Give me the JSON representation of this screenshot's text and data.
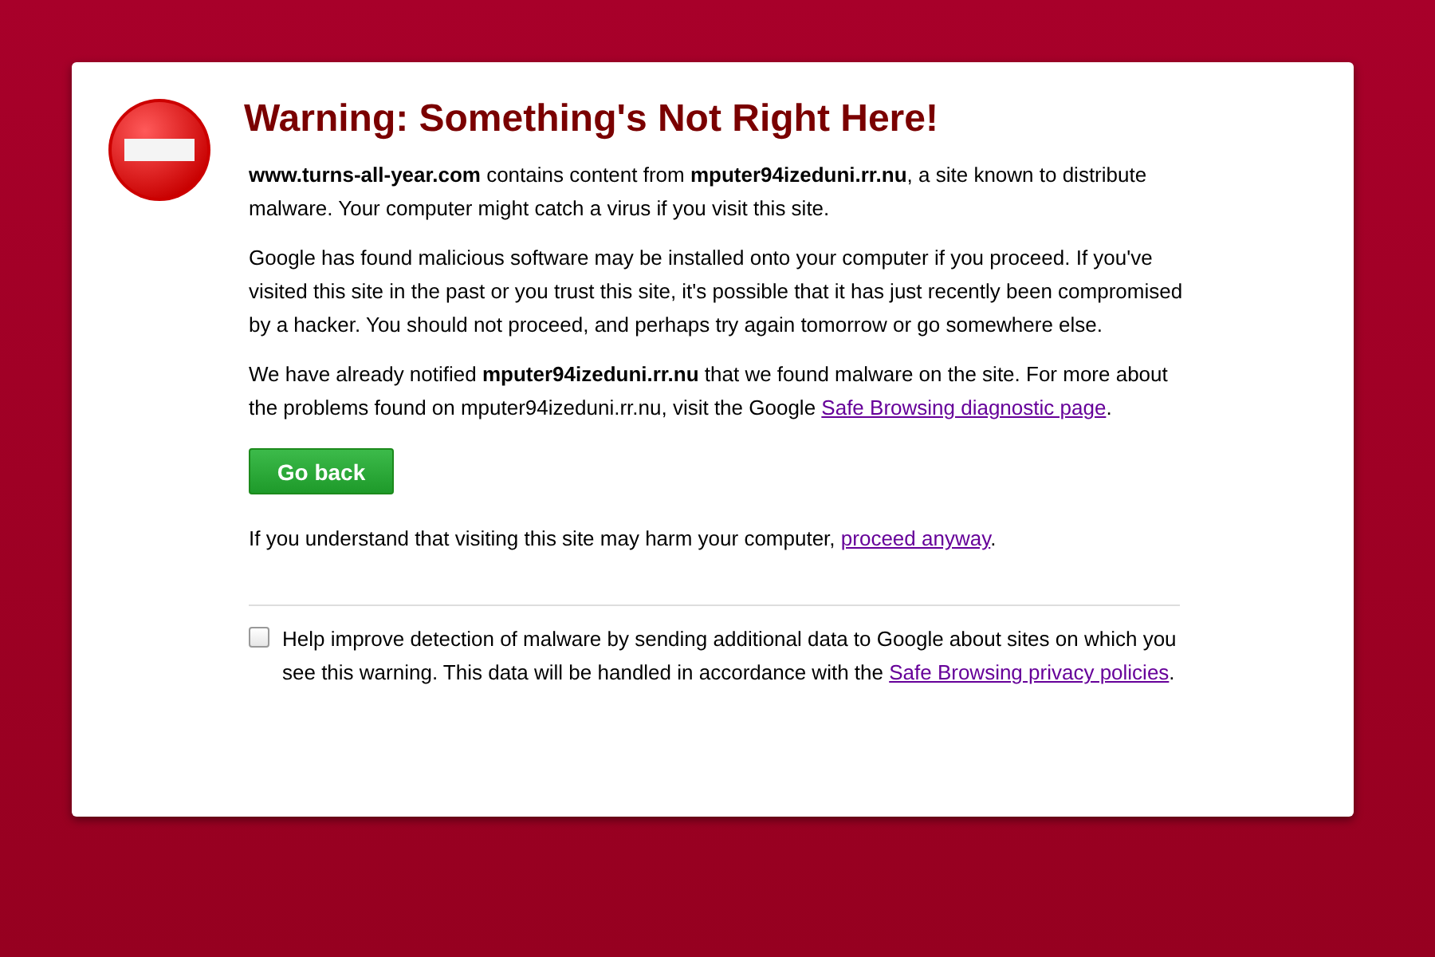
{
  "title": "Warning: Something's Not Right Here!",
  "paragraphs": [
    {
      "parts": [
        {
          "kind": "text",
          "text": "**www.turns-all-year.com** contains content from **mputer94izeduni.rr.nu**, a site known to distribute malware. Your computer might catch a virus if you visit this site."
        }
      ]
    },
    {
      "parts": [
        {
          "kind": "text",
          "text": "Google has found malicious software may be installed onto your computer if you proceed. If you've visited this site in the past or you trust this site, it's possible that it has just recently been compromised by a hacker. You should not proceed, and perhaps try again tomorrow or go somewhere else."
        }
      ]
    },
    {
      "parts": [
        {
          "kind": "text",
          "text": "We have already notified **mputer94izeduni.rr.nu** that we found malware on the site. For more about the problems found on mputer94izeduni.rr.nu, visit the Google "
        },
        {
          "kind": "link",
          "text": "Safe Browsing diagnostic page"
        },
        {
          "kind": "text",
          "text": "."
        }
      ]
    }
  ],
  "button": "Go back",
  "proceed": {
    "parts": [
      {
        "kind": "text",
        "text": "If you understand that visiting this site may harm your computer, "
      },
      {
        "kind": "link",
        "text": "proceed anyway"
      },
      {
        "kind": "text",
        "text": "."
      }
    ]
  },
  "report": {
    "checked": false,
    "parts": [
      {
        "kind": "text",
        "text": "Help improve detection of malware by sending additional data to Google about sites on which you see this warning. This data will be handled in accordance with the "
      },
      {
        "kind": "link",
        "text": "Safe Browsing privacy policies"
      },
      {
        "kind": "text",
        "text": "."
      }
    ]
  }
}
